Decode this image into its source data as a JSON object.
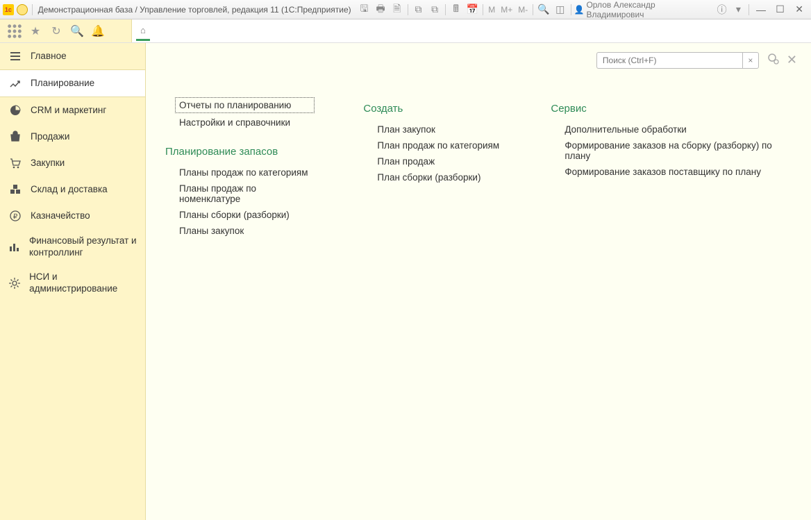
{
  "titlebar": {
    "title": "Демонстрационная база / Управление торговлей, редакция 11  (1С:Предприятие)",
    "user": "Орлов Александр Владимирович",
    "m_labels": [
      "M",
      "M+",
      "M-"
    ]
  },
  "search": {
    "placeholder": "Поиск (Ctrl+F)"
  },
  "sidebar": {
    "items": [
      {
        "label": "Главное",
        "icon": "menu"
      },
      {
        "label": "Планирование",
        "icon": "chart-up"
      },
      {
        "label": "CRM и маркетинг",
        "icon": "pie"
      },
      {
        "label": "Продажи",
        "icon": "bag"
      },
      {
        "label": "Закупки",
        "icon": "cart"
      },
      {
        "label": "Склад и доставка",
        "icon": "boxes"
      },
      {
        "label": "Казначейство",
        "icon": "ruble"
      },
      {
        "label": "Финансовый результат и контроллинг",
        "icon": "bars"
      },
      {
        "label": "НСИ и администрирование",
        "icon": "gear"
      }
    ]
  },
  "content": {
    "col1_top": [
      "Отчеты по планированию",
      "Настройки и справочники"
    ],
    "col1_section": "Планирование запасов",
    "col1_items": [
      "Планы продаж по категориям",
      "Планы продаж по номенклатуре",
      "Планы сборки (разборки)",
      "Планы закупок"
    ],
    "col2_section": "Создать",
    "col2_items": [
      "План закупок",
      "План продаж по категориям",
      "План продаж",
      "План сборки (разборки)"
    ],
    "col3_section": "Сервис",
    "col3_items": [
      "Дополнительные обработки",
      "Формирование заказов на сборку (разборку) по плану",
      "Формирование заказов поставщику по плану"
    ]
  }
}
